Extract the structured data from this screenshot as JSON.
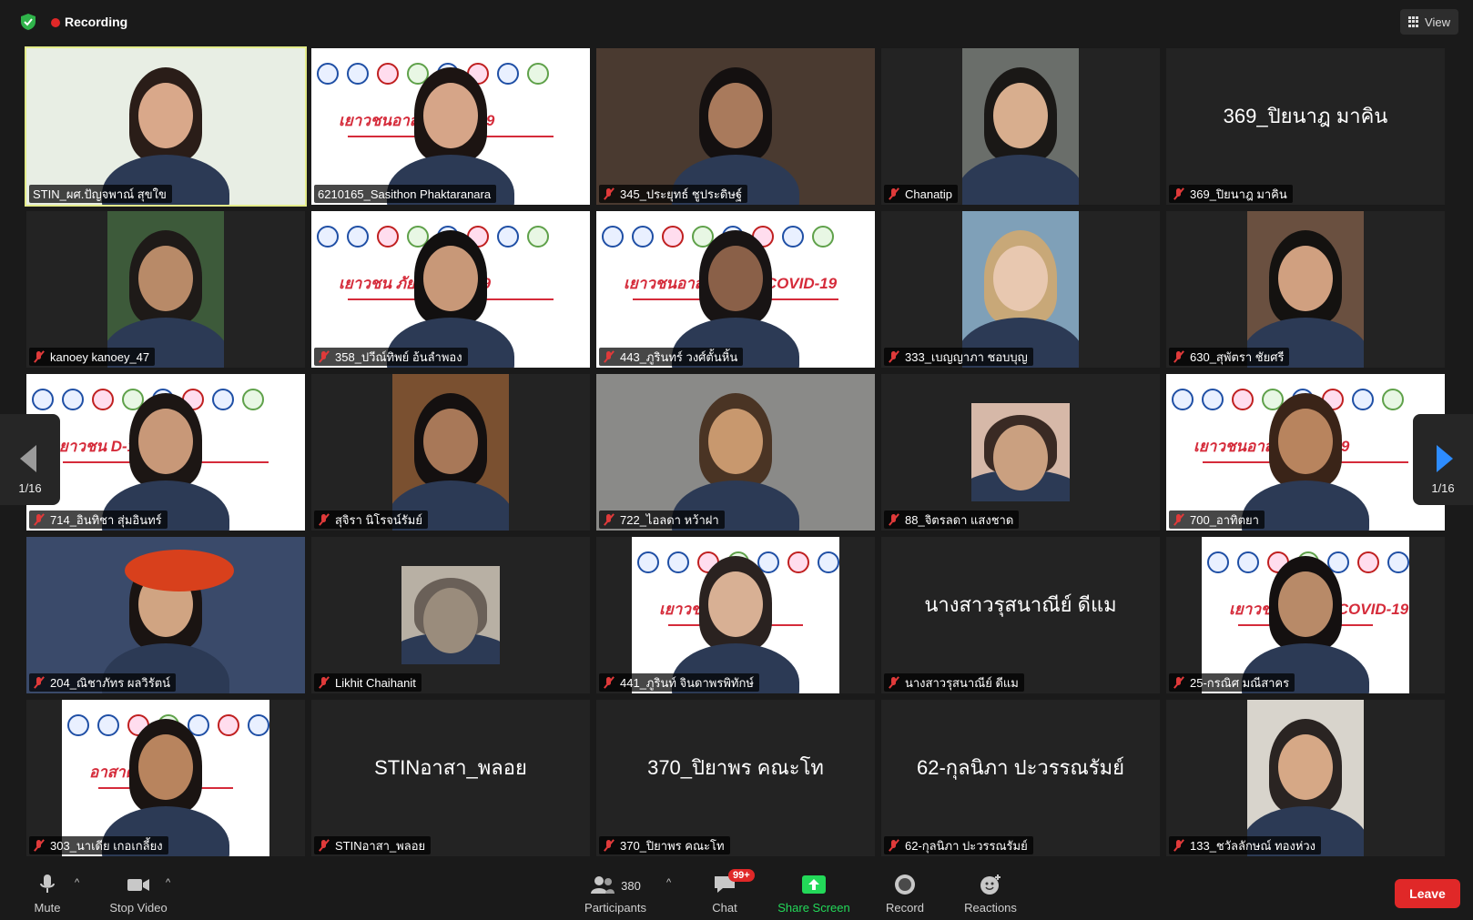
{
  "topbar": {
    "recording_label": "Recording",
    "view_label": "View"
  },
  "pagination": {
    "left": "1/16",
    "right": "1/16"
  },
  "tiles": [
    {
      "name": "STIN_ผศ.ปัญจพาณ์ สุขใข",
      "type": "video",
      "active": true,
      "muted": false,
      "bg": "#e8eee4",
      "skin": "#d9a88a",
      "hair": "#2a1d18"
    },
    {
      "name": "6210165_Sasithon Phaktaranara",
      "type": "banner",
      "muted": false,
      "banner_text": "เยาวชนอาส  COVID-19",
      "skin": "#d6a588",
      "hair": "#1c1412"
    },
    {
      "name": "345_ประยุทธ์ ชูประดิษฐ์",
      "type": "video",
      "muted": true,
      "bg": "#4a3a30",
      "skin": "#a97a5c",
      "hair": "#141010"
    },
    {
      "name": "Chanatip",
      "type": "video_narrow",
      "muted": true,
      "bg": "#6a6e6a",
      "skin": "#d8ae8e",
      "hair": "#1a1816"
    },
    {
      "name": "369_ปิยนาฎ มาคิน",
      "type": "nameonly",
      "muted": true,
      "bigname": "369_ปิยนาฎ มาคิน"
    },
    {
      "name": "kanoey kanoey_47",
      "type": "video_narrow",
      "muted": true,
      "bg": "#3d5a3a",
      "skin": "#b88a68",
      "hair": "#1e1a18"
    },
    {
      "name": "358_ปวีณ์ทิพย์ อ้นลำพอง",
      "type": "banner",
      "muted": true,
      "banner_text": "เยาวชน   ภัย COVID-19",
      "skin": "#c89878",
      "hair": "#121010"
    },
    {
      "name": "443_ภูรินทร์ วงศ์ตั้นหิ้น",
      "type": "banner",
      "muted": true,
      "banner_text": "เยาวชนอาสาต้านภัย COVID-19",
      "skin": "#8a6048",
      "hair": "#181414"
    },
    {
      "name": "333_เบญญาภา ชอบบุญ",
      "type": "video_narrow",
      "muted": true,
      "bg": "#7fa0b8",
      "skin": "#e8c8b0",
      "hair": "#c8a878"
    },
    {
      "name": "630_สุพัตรา ชัยศรี",
      "type": "video_narrow",
      "muted": true,
      "bg": "#6a5040",
      "skin": "#d0a080",
      "hair": "#141210"
    },
    {
      "name": "714_อินทิชา สุ่มอินทร์",
      "type": "banner",
      "muted": true,
      "banner_text": "เยาวชน       D-19",
      "skin": "#c89878",
      "hair": "#1c1614"
    },
    {
      "name": "สุจิรา นิโรจน์รัมย์",
      "type": "video_narrow",
      "muted": true,
      "bg": "#7a5030",
      "skin": "#a87858",
      "hair": "#141010"
    },
    {
      "name": "722_ไอลดา หว้าฝา",
      "type": "video",
      "muted": true,
      "bg": "#8a8a88",
      "skin": "#c8986e",
      "hair": "#4a3424"
    },
    {
      "name": "88_จิตรลดา แสงชาด",
      "type": "video_small",
      "muted": true,
      "bg": "#d6b8a8",
      "skin": "#caa080",
      "hair": "#3a2a24"
    },
    {
      "name": "700_อาทิตยา",
      "type": "banner",
      "muted": true,
      "banner_text": "เยาวชนอาส     COVID-19",
      "skin": "#b8845e",
      "hair": "#3a2418"
    },
    {
      "name": "204_ณิชาภัทร ผลวิรัตน์",
      "type": "video",
      "muted": true,
      "bg": "#3a4a6a",
      "skin": "#d0a482",
      "hair": "#1a1412",
      "beret": true
    },
    {
      "name": "Likhit Chaihanit",
      "type": "video_small",
      "muted": true,
      "bg": "#b8b0a4",
      "skin": "#9a8c7c",
      "hair": "#6a6058"
    },
    {
      "name": "441_ภูรินท์ จินดาพรพิทักษ์",
      "type": "banner_narrow",
      "muted": true,
      "banner_text": "เยาวชนอาสา",
      "skin": "#d8b094",
      "hair": "#2a2220"
    },
    {
      "name": "นางสาวรุสนาณีย์ ดีแม",
      "type": "nameonly",
      "muted": true,
      "bigname": "นางสาวรุสนาณีย์ ดีแม"
    },
    {
      "name": "25-กรณิศ มณีสาคร",
      "type": "banner_narrow",
      "muted": true,
      "banner_text": "เยาวชนอาส   ภัย COVID-19",
      "skin": "#b88a68",
      "hair": "#141010"
    },
    {
      "name": "303_นาเดีย เกอเกลี้ยง",
      "type": "banner_narrow",
      "muted": true,
      "banner_text": "อาสาต้านภัย CO",
      "skin": "#b8845e",
      "hair": "#1a1412"
    },
    {
      "name": "STINอาสา_พลอย",
      "type": "nameonly",
      "muted": true,
      "bigname": "STINอาสา_พลอย"
    },
    {
      "name": "370_ปิยาพร คณะโท",
      "type": "nameonly",
      "muted": true,
      "bigname": "370_ปิยาพร คณะโท"
    },
    {
      "name": "62-กุลนิภา ปะวรรณรัมย์",
      "type": "nameonly",
      "muted": true,
      "bigname": "62-กุลนิภา ปะวรรณรัมย์"
    },
    {
      "name": "133_ชวัลลักษณ์ ทองห่วง",
      "type": "video_narrow",
      "muted": true,
      "bg": "#d8d4cc",
      "skin": "#d6a886",
      "hair": "#2a2422"
    }
  ],
  "toolbar": {
    "mute": "Mute",
    "stop_video": "Stop Video",
    "participants": "Participants",
    "participants_count": "380",
    "chat": "Chat",
    "chat_badge": "99+",
    "share_screen": "Share Screen",
    "record": "Record",
    "reactions": "Reactions",
    "leave": "Leave"
  },
  "colors": {
    "share_green": "#23d959",
    "leave_red": "#e02828",
    "accent_blue": "#2d8cff"
  }
}
